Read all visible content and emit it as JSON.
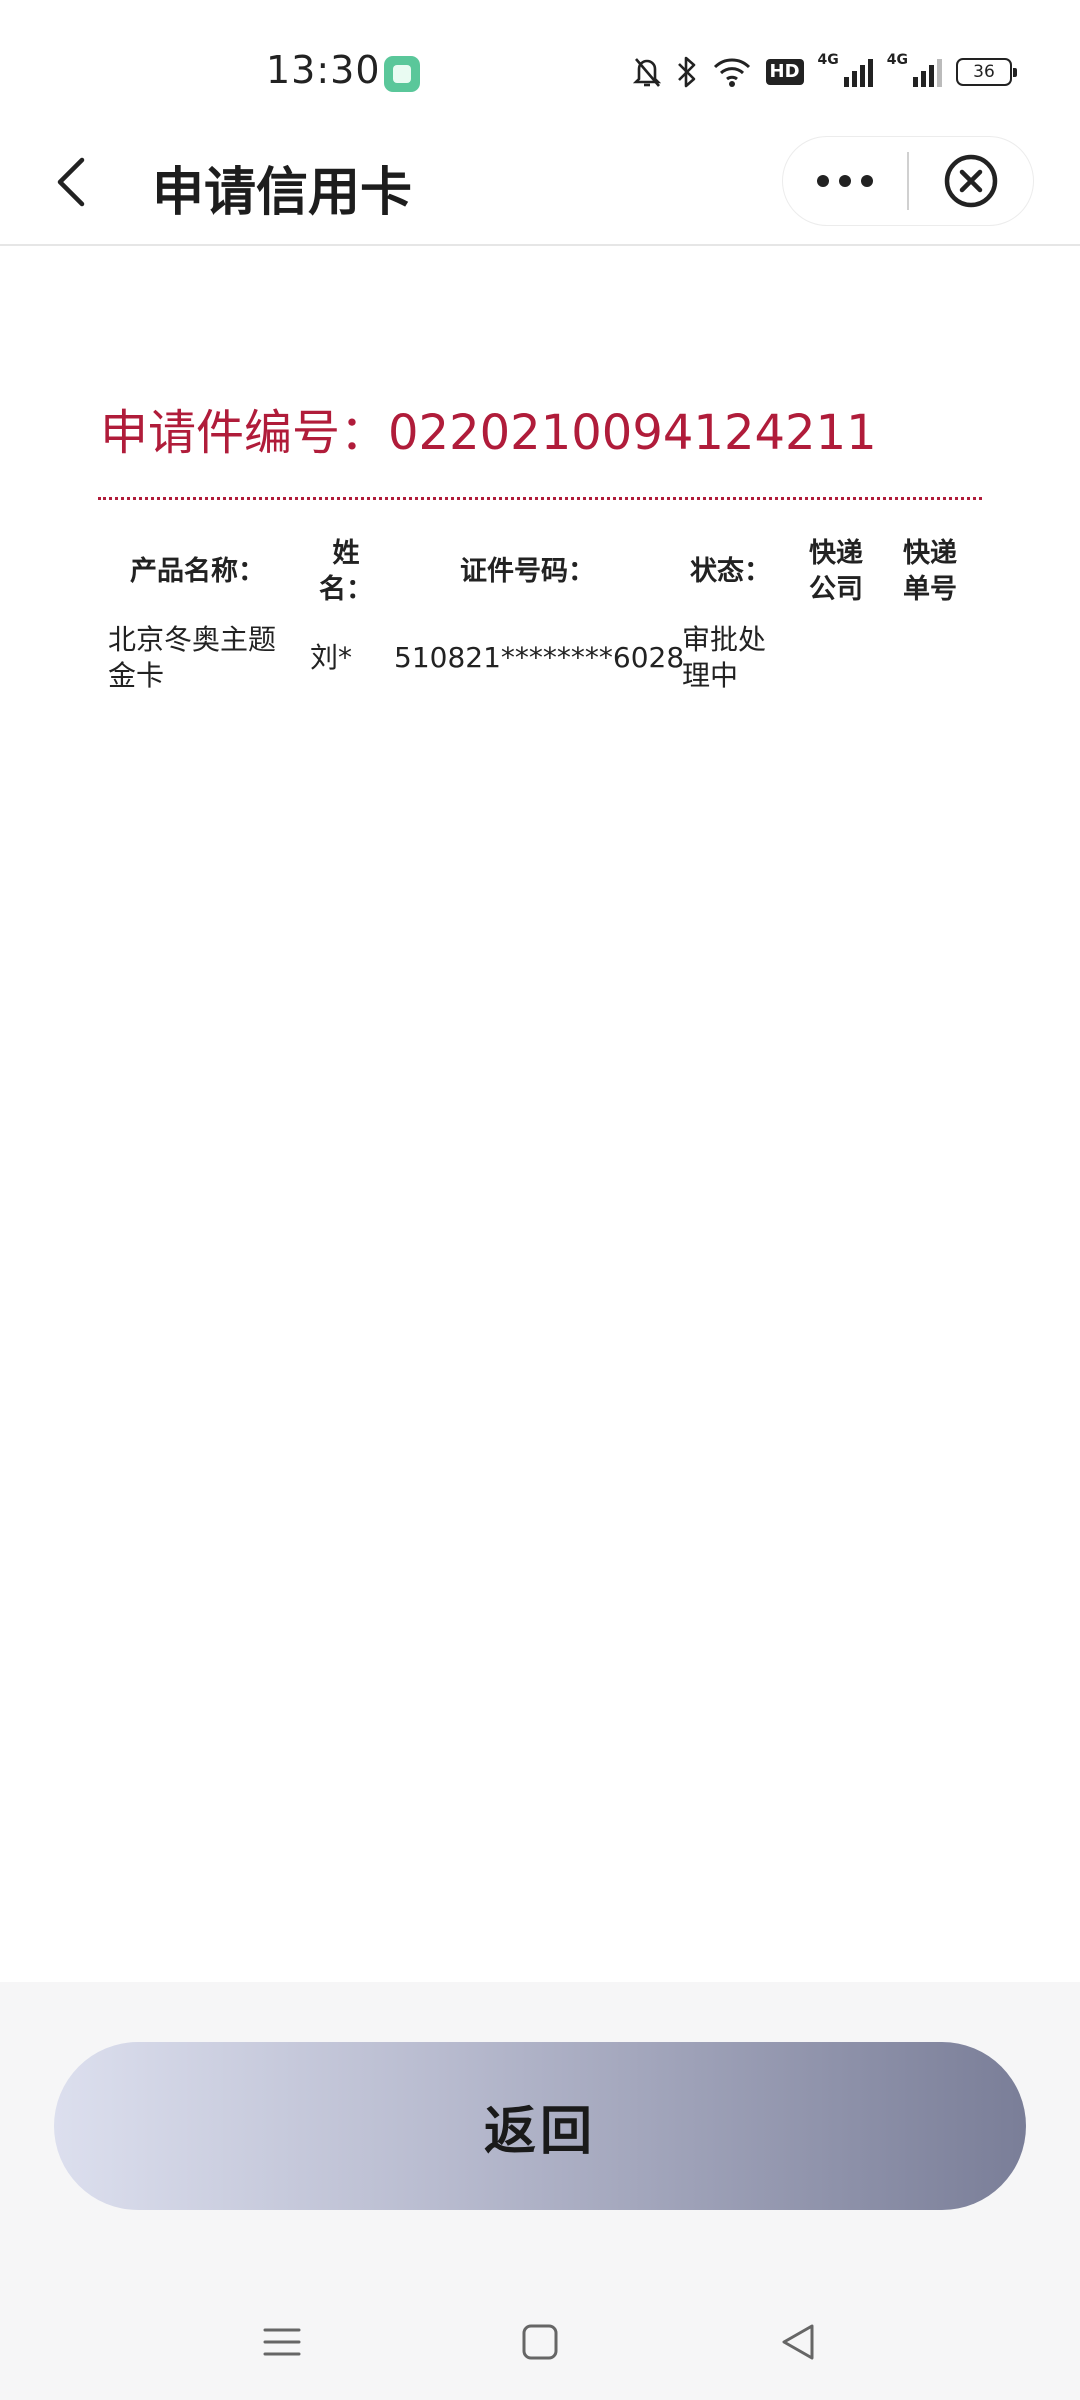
{
  "status_bar": {
    "time": "13:30",
    "hd_badge": "HD",
    "network_1": "4G",
    "network_2": "4G",
    "battery": "36",
    "icons": [
      "app-notification-icon",
      "mute-bell-icon",
      "bluetooth-icon",
      "wifi-icon",
      "hd-icon",
      "signal-icon",
      "signal-icon",
      "battery-icon"
    ]
  },
  "nav": {
    "title": "申请信用卡",
    "back_icon": "chevron-left-icon",
    "more_icon": "more-dots-icon",
    "close_icon": "close-circle-icon"
  },
  "application": {
    "label": "申请件编号：",
    "number": "0220210094124211"
  },
  "table": {
    "headers": {
      "product": "产品名称：",
      "name": "姓名：",
      "id_no": "证件号码：",
      "status": "状态：",
      "courier": "快递公司",
      "tracking": "快递单号"
    },
    "rows": [
      {
        "product": "北京冬奥主题金卡",
        "name": "刘*",
        "id_no": "510821********6028",
        "status": "审批处理中",
        "courier": "",
        "tracking": ""
      }
    ]
  },
  "footer": {
    "return_label": "返回"
  },
  "system_nav": {
    "icons": [
      "menu-icon",
      "home-square-icon",
      "back-triangle-icon"
    ]
  },
  "colors": {
    "accent_red": "#b01c3a",
    "button_gradient_start": "#dcdfee",
    "button_gradient_end": "#7a7e98"
  }
}
